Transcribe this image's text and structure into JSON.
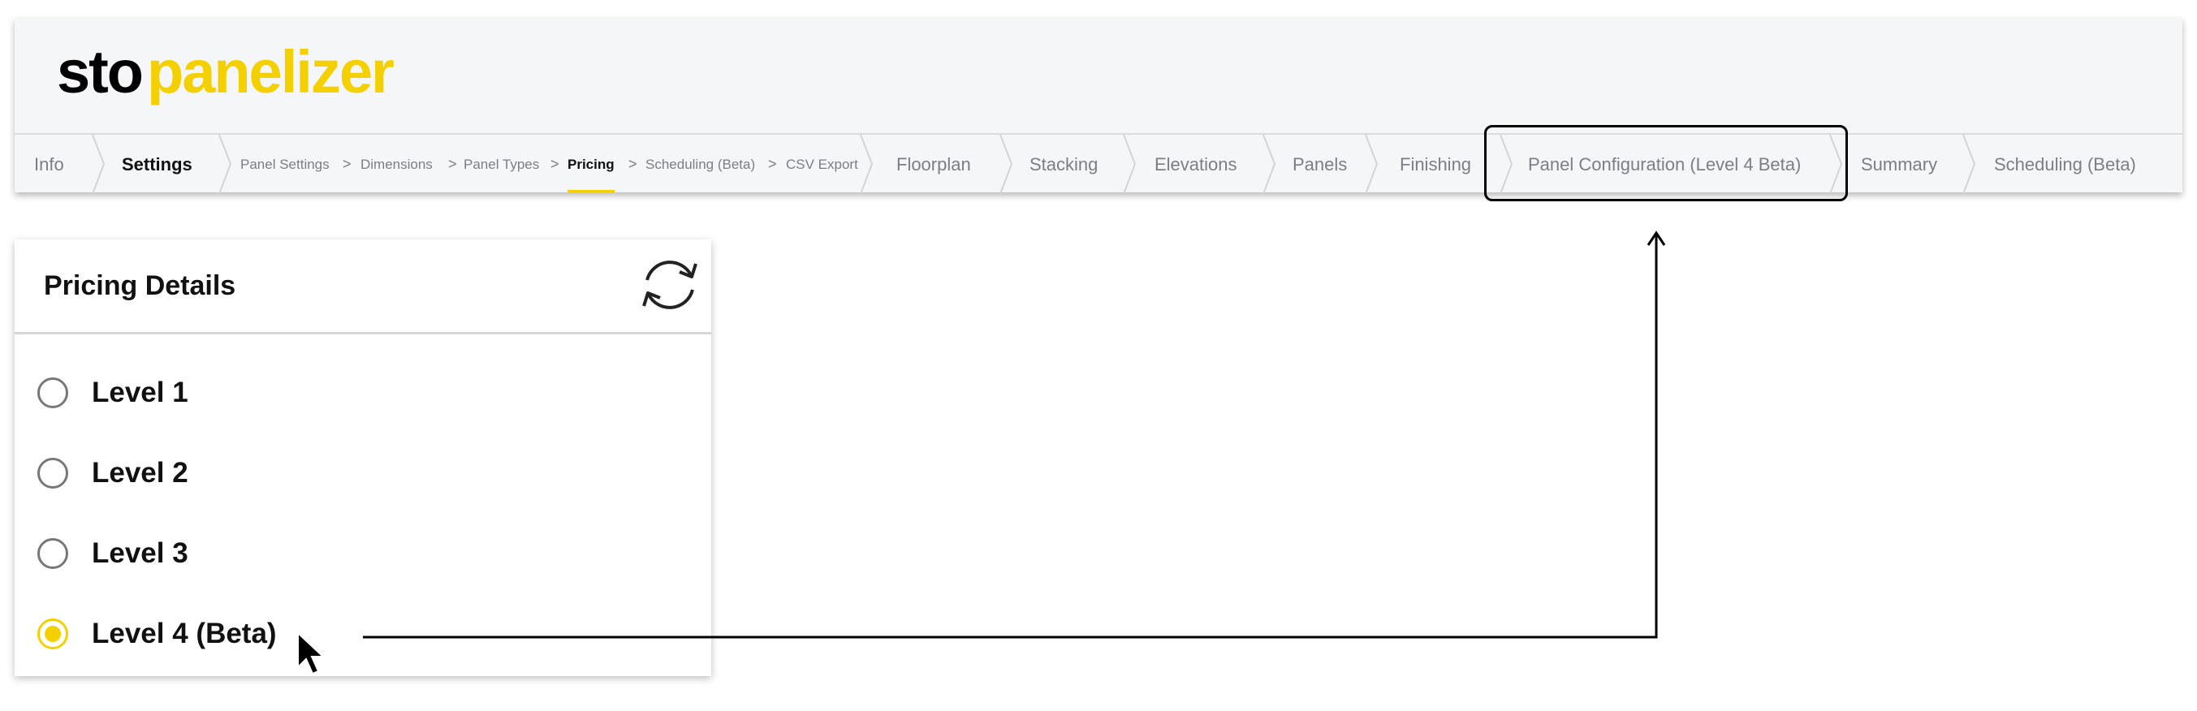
{
  "logo": {
    "part1": "sto",
    "part2": "panelizer"
  },
  "nav": {
    "info": "Info",
    "settings": "Settings",
    "sub": [
      "Panel Settings",
      "Dimensions",
      "Panel Types",
      "Pricing",
      "Scheduling (Beta)",
      "CSV Export"
    ],
    "sub_separator": ">",
    "floorplan": "Floorplan",
    "stacking": "Stacking",
    "elevations": "Elevations",
    "panels": "Panels",
    "finishing": "Finishing",
    "panel_configuration": "Panel Configuration (Level 4 Beta)",
    "summary": "Summary",
    "scheduling": "Scheduling (Beta)"
  },
  "pricing": {
    "title": "Pricing Details",
    "options": [
      "Level 1",
      "Level 2",
      "Level 3",
      "Level 4 (Beta)"
    ],
    "selected": "Level 4 (Beta)"
  },
  "icons": [
    "refresh-icon",
    "cursor-icon",
    "arrow-up-icon"
  ],
  "colors": {
    "accent": "#f5d000",
    "header_bg": "#f5f6f7",
    "muted_text": "#7b7f84"
  }
}
